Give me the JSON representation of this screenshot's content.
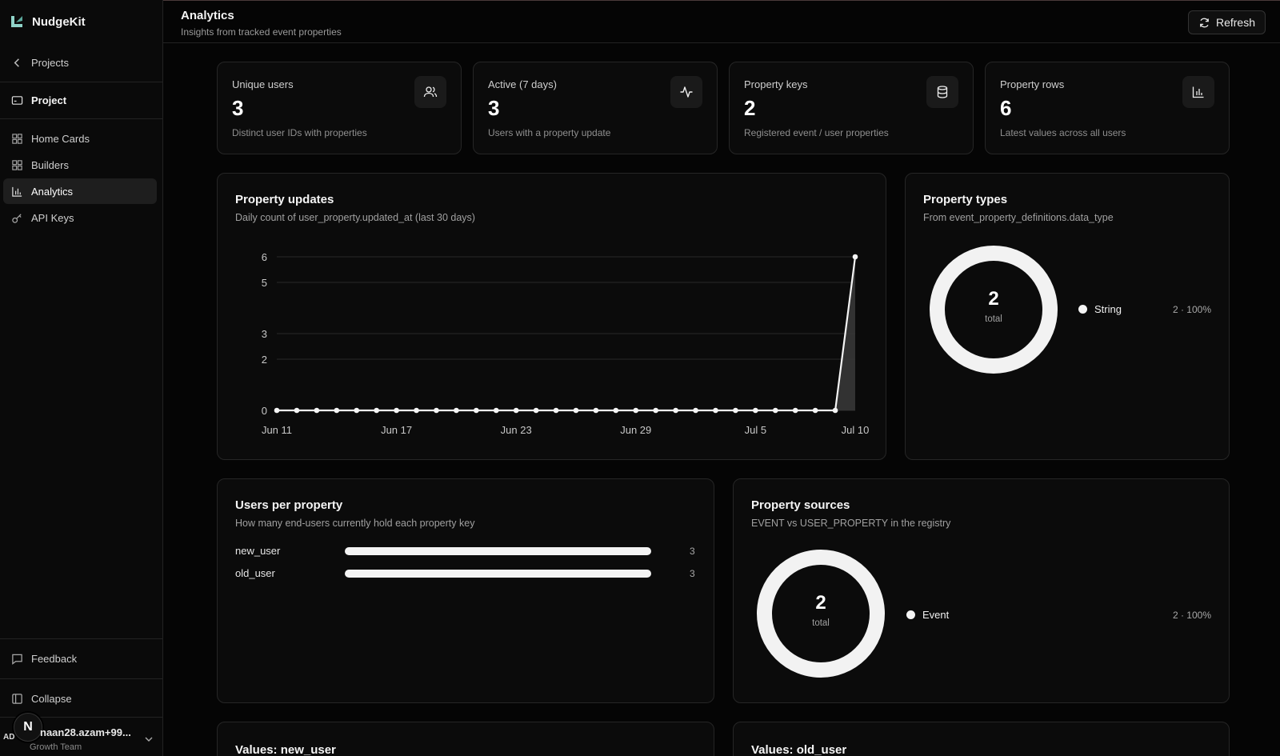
{
  "app": {
    "name": "NudgeKit"
  },
  "sidebar": {
    "back_label": "Projects",
    "project_label": "Project",
    "items": [
      {
        "label": "Home Cards",
        "icon": "grid-icon"
      },
      {
        "label": "Builders",
        "icon": "grid-icon"
      },
      {
        "label": "Analytics",
        "icon": "bar-chart-icon",
        "active": true
      },
      {
        "label": "API Keys",
        "icon": "key-icon"
      }
    ],
    "feedback_label": "Feedback",
    "collapse_label": "Collapse",
    "user": {
      "initials": "AD",
      "avatar_letter": "N",
      "email": "naan28.azam+99...",
      "team": "Growth Team"
    }
  },
  "header": {
    "title": "Analytics",
    "subtitle": "Insights from tracked event properties",
    "refresh_label": "Refresh"
  },
  "stats": [
    {
      "label": "Unique users",
      "value": "3",
      "note": "Distinct user IDs with properties",
      "icon": "users-icon"
    },
    {
      "label": "Active (7 days)",
      "value": "3",
      "note": "Users with a property update",
      "icon": "activity-icon"
    },
    {
      "label": "Property keys",
      "value": "2",
      "note": "Registered event / user properties",
      "icon": "database-icon"
    },
    {
      "label": "Property rows",
      "value": "6",
      "note": "Latest values across all users",
      "icon": "bar-chart-icon"
    }
  ],
  "property_updates": {
    "title": "Property updates",
    "subtitle": "Daily count of user_property.updated_at (last 30 days)"
  },
  "property_types": {
    "title": "Property types",
    "subtitle": "From event_property_definitions.data_type",
    "total": "2",
    "total_caption": "total",
    "legend": [
      {
        "label": "String",
        "value": "2 · 100%",
        "color": "#f5f5f5"
      }
    ]
  },
  "users_per_property": {
    "title": "Users per property",
    "subtitle": "How many end-users currently hold each property key",
    "rows": [
      {
        "key": "new_user",
        "count": "3",
        "fraction": 1.0
      },
      {
        "key": "old_user",
        "count": "3",
        "fraction": 1.0
      }
    ]
  },
  "property_sources": {
    "title": "Property sources",
    "subtitle": "EVENT vs USER_PROPERTY in the registry",
    "total": "2",
    "total_caption": "total",
    "legend": [
      {
        "label": "Event",
        "value": "2 · 100%",
        "color": "#f5f5f5"
      }
    ]
  },
  "values_new_user": {
    "title": "Values: new_user"
  },
  "values_old_user": {
    "title": "Values: old_user"
  },
  "chart_data": {
    "type": "area",
    "title": "Property updates",
    "x": [
      "Jun 11",
      "Jun 12",
      "Jun 13",
      "Jun 14",
      "Jun 15",
      "Jun 16",
      "Jun 17",
      "Jun 18",
      "Jun 19",
      "Jun 20",
      "Jun 21",
      "Jun 22",
      "Jun 23",
      "Jun 24",
      "Jun 25",
      "Jun 26",
      "Jun 27",
      "Jun 28",
      "Jun 29",
      "Jun 30",
      "Jul 1",
      "Jul 2",
      "Jul 3",
      "Jul 4",
      "Jul 5",
      "Jul 6",
      "Jul 7",
      "Jul 8",
      "Jul 9",
      "Jul 10"
    ],
    "x_tick_labels": [
      "Jun 11",
      "Jun 17",
      "Jun 23",
      "Jun 29",
      "Jul 5",
      "Jul 10"
    ],
    "y_ticks": [
      0,
      2,
      3,
      5,
      6
    ],
    "ylim": [
      0,
      6
    ],
    "series": [
      {
        "values": [
          0,
          0,
          0,
          0,
          0,
          0,
          0,
          0,
          0,
          0,
          0,
          0,
          0,
          0,
          0,
          0,
          0,
          0,
          0,
          0,
          0,
          0,
          0,
          0,
          0,
          0,
          0,
          0,
          0,
          6
        ]
      }
    ],
    "grid": true,
    "color": "#f5f5f5"
  }
}
